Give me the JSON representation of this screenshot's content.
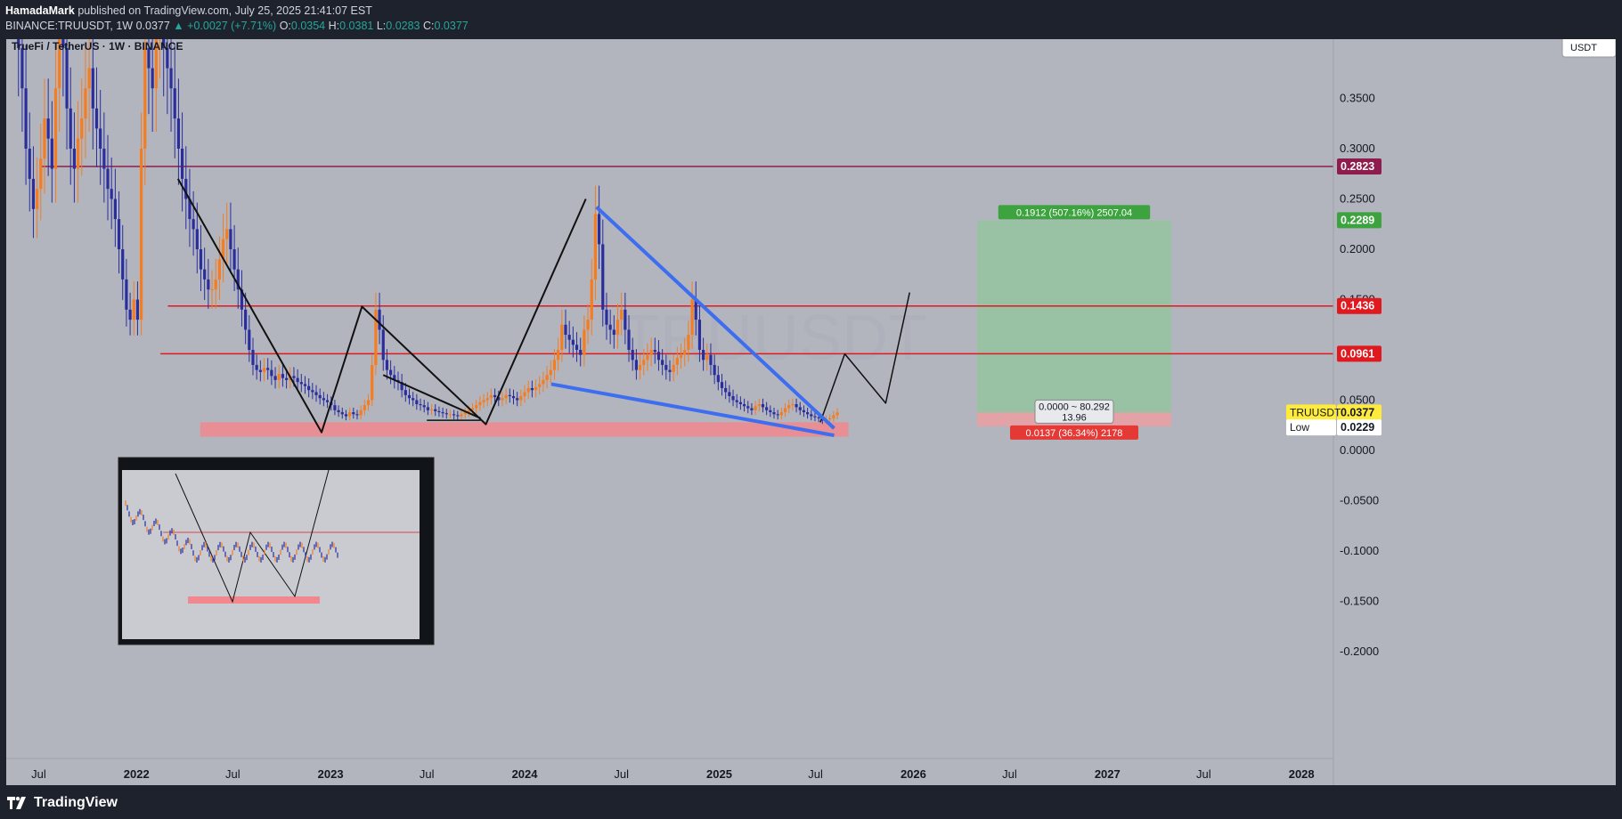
{
  "publisher": {
    "author": "HamadaMark",
    "text": "published on TradingView.com, July 25, 2025 21:41:07 EST"
  },
  "ohlc": {
    "symbol": "BINANCE:TRUUSDT, 1W",
    "last": "0.0377",
    "change": "+0.0027 (+7.71%)",
    "o_label": "O:",
    "o": "0.0354",
    "h_label": "H:",
    "h": "0.0381",
    "l_label": "L:",
    "l": "0.0283",
    "c_label": "C:",
    "c": "0.0377"
  },
  "chart_title": "TrueFi / TetherUS · 1W · BINANCE",
  "currency_button": "USDT",
  "watermark": "TRUUSDT",
  "brand": "TradingView",
  "colors": {
    "background": "#b2b5be",
    "up_candle": "#f57c1f",
    "down_candle": "#2a2e9c",
    "horizontal_level": "#e0191f",
    "top_level": "#8e1c4e",
    "wedge_line": "#3d6df0",
    "target_zone": "#8fc79a",
    "stop_zone": "#e8a0a3",
    "support_zone": "#f0888e"
  },
  "chart_data": {
    "type": "candlestick",
    "symbol": "TRUUSDT",
    "interval": "1W",
    "yaxis": {
      "ticks": [
        "0.3500",
        "0.3000",
        "0.2500",
        "0.2000",
        "0.1500",
        "0.0500",
        "0.0000",
        "-0.0500",
        "-0.1000",
        "-0.1500",
        "-0.2000"
      ],
      "range": [
        -0.2,
        0.38
      ]
    },
    "xaxis": {
      "ticks": [
        "Jul",
        "2022",
        "Jul",
        "2023",
        "Jul",
        "2024",
        "Jul",
        "2025",
        "Jul",
        "2026",
        "Jul",
        "2027",
        "Jul",
        "2028"
      ],
      "range": [
        "2021-05",
        "2028-03"
      ]
    },
    "price_labels": [
      {
        "value": "0.2823",
        "kind": "level"
      },
      {
        "value": "0.2289",
        "kind": "target"
      },
      {
        "value": "0.1436",
        "kind": "level"
      },
      {
        "value": "0.0961",
        "kind": "level"
      },
      {
        "name": "TRUUSDT",
        "value": "0.0377",
        "kind": "last"
      },
      {
        "name": "Low",
        "value": "0.0229",
        "kind": "low"
      }
    ],
    "horizontal_levels": [
      0.2823,
      0.1436,
      0.0961
    ],
    "support_zone": {
      "from": 0.0137,
      "to": 0.028,
      "start": "2022-05",
      "end": "2025-09"
    },
    "position": {
      "entry": 0.0377,
      "target": 0.2289,
      "stop": 0.024,
      "start": "2026-05",
      "end": "2027-05",
      "target_label": "0.1912 (507.16%) 2507.04",
      "stop_label": "0.0137 (36.34%) 2178",
      "center_label_1": "0.0000 ~ 80.292",
      "center_label_2": "13.96"
    },
    "candles": {
      "start": "2021-05-03",
      "comment": "weekly closes, approximate",
      "close": [
        0.62,
        0.55,
        0.48,
        0.4,
        0.36,
        0.3,
        0.27,
        0.24,
        0.26,
        0.29,
        0.33,
        0.31,
        0.28,
        0.36,
        0.42,
        0.4,
        0.34,
        0.3,
        0.28,
        0.31,
        0.33,
        0.36,
        0.38,
        0.34,
        0.32,
        0.3,
        0.28,
        0.26,
        0.25,
        0.23,
        0.2,
        0.17,
        0.14,
        0.13,
        0.15,
        0.13,
        0.3,
        0.4,
        0.38,
        0.36,
        0.42,
        0.44,
        0.4,
        0.38,
        0.36,
        0.33,
        0.3,
        0.27,
        0.25,
        0.23,
        0.22,
        0.2,
        0.18,
        0.17,
        0.16,
        0.16,
        0.17,
        0.19,
        0.21,
        0.22,
        0.2,
        0.18,
        0.16,
        0.14,
        0.12,
        0.1,
        0.085,
        0.08,
        0.078,
        0.082,
        0.08,
        0.074,
        0.07,
        0.076,
        0.072,
        0.07,
        0.074,
        0.072,
        0.068,
        0.066,
        0.064,
        0.06,
        0.058,
        0.055,
        0.052,
        0.05,
        0.048,
        0.045,
        0.04,
        0.038,
        0.036,
        0.034,
        0.038,
        0.036,
        0.035,
        0.04,
        0.045,
        0.05,
        0.085,
        0.14,
        0.12,
        0.09,
        0.08,
        0.075,
        0.07,
        0.068,
        0.06,
        0.055,
        0.052,
        0.05,
        0.046,
        0.045,
        0.043,
        0.04,
        0.041,
        0.039,
        0.038,
        0.037,
        0.036,
        0.036,
        0.035,
        0.034,
        0.036,
        0.038,
        0.04,
        0.042,
        0.045,
        0.048,
        0.05,
        0.052,
        0.055,
        0.053,
        0.05,
        0.052,
        0.055,
        0.054,
        0.052,
        0.05,
        0.054,
        0.058,
        0.062,
        0.06,
        0.063,
        0.066,
        0.07,
        0.075,
        0.08,
        0.09,
        0.1,
        0.125,
        0.115,
        0.11,
        0.105,
        0.1,
        0.095,
        0.12,
        0.13,
        0.17,
        0.235,
        0.205,
        0.14,
        0.125,
        0.12,
        0.115,
        0.13,
        0.14,
        0.12,
        0.1,
        0.09,
        0.08,
        0.085,
        0.09,
        0.095,
        0.1,
        0.098,
        0.09,
        0.085,
        0.08,
        0.078,
        0.085,
        0.092,
        0.095,
        0.1,
        0.115,
        0.15,
        0.13,
        0.1,
        0.09,
        0.095,
        0.085,
        0.075,
        0.068,
        0.062,
        0.058,
        0.054,
        0.05,
        0.048,
        0.046,
        0.044,
        0.042,
        0.04,
        0.044,
        0.046,
        0.043,
        0.04,
        0.038,
        0.036,
        0.035,
        0.038,
        0.042,
        0.045,
        0.046,
        0.043,
        0.04,
        0.038,
        0.036,
        0.034,
        0.033,
        0.032,
        0.03,
        0.031,
        0.032,
        0.035,
        0.0377
      ]
    }
  }
}
